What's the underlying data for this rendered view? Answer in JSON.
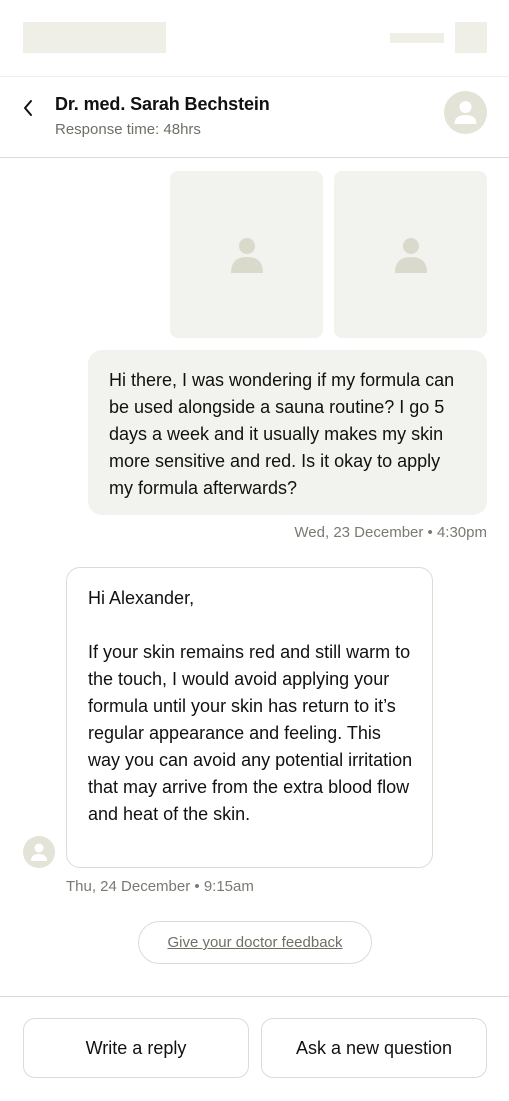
{
  "header": {
    "doctor_name": "Dr. med. Sarah Bechstein",
    "response_time": "Response time: 48hrs"
  },
  "messages": {
    "outgoing": {
      "text": "Hi there, I was wondering if my formula can be used alongside a sauna routine? I go 5 days a week and it usually makes my skin more sensitive and red. Is it okay to apply my formula afterwards?",
      "timestamp": "Wed, 23 December • 4:30pm"
    },
    "incoming": {
      "greeting": "Hi Alexander,",
      "body": "If your skin remains red and still warm to the touch, I would avoid applying your formula until your skin has return to it’s regular appearance and feeling. This way you can avoid any potential irritation that may arrive from the extra blood flow and heat of the skin.",
      "timestamp": "Thu, 24 December • 9:15am"
    }
  },
  "feedback": {
    "label": "Give your doctor feedback"
  },
  "footer": {
    "reply_label": "Write a reply",
    "ask_label": "Ask a new question"
  },
  "icons": {
    "back": "chevron-left-icon",
    "avatar": "user-placeholder-icon",
    "image": "image-placeholder-icon"
  },
  "colors": {
    "placeholder": "#efefe8",
    "bubble_out": "#f2f2ee",
    "border": "#dcdcd0",
    "avatar_bg": "#e3e3d7",
    "muted_text": "#7a7a72"
  }
}
